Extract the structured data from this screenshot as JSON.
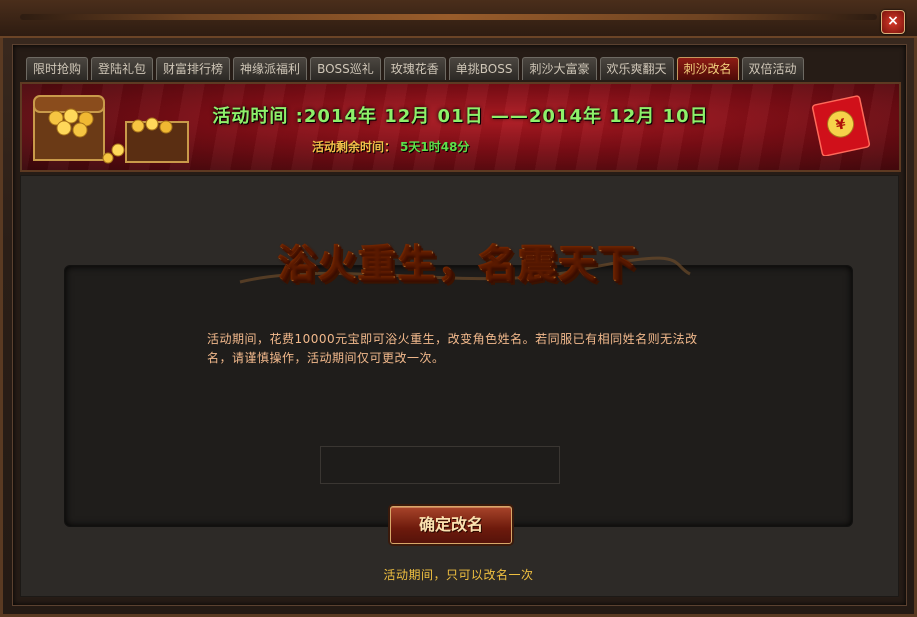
{
  "tabs": [
    {
      "label": "限时抢购",
      "active": false
    },
    {
      "label": "登陆礼包",
      "active": false
    },
    {
      "label": "财富排行榜",
      "active": false
    },
    {
      "label": "神缘派福利",
      "active": false
    },
    {
      "label": "BOSS巡礼",
      "active": false
    },
    {
      "label": "玫瑰花香",
      "active": false
    },
    {
      "label": "单挑BOSS",
      "active": false
    },
    {
      "label": "刺沙大富豪",
      "active": false
    },
    {
      "label": "欢乐爽翻天",
      "active": false
    },
    {
      "label": "刺沙改名",
      "active": true
    },
    {
      "label": "双倍活动",
      "active": false
    }
  ],
  "banner": {
    "time_text": "活动时间 :2014年 12月 01日 ——2014年 12月 10日",
    "remaining_label": "活动剩余时间：",
    "remaining_value": "5天1时48分"
  },
  "main": {
    "headline": "浴火重生，名震天下",
    "description": "活动期间，花费10000元宝即可浴火重生，改变角色姓名。若同服已有相同姓名则无法改名，请谨慎操作，活动期间仅可更改一次。",
    "name_input_value": "",
    "confirm_label": "确定改名",
    "footer_note": "活动期间，只可以改名一次"
  },
  "close_label": "×",
  "colors": {
    "active_tab": "#8d1c14",
    "time_text": "#8ef06a",
    "remaining_label": "#f3c04a",
    "description": "#f2b98c",
    "footer": "#f0c040"
  }
}
